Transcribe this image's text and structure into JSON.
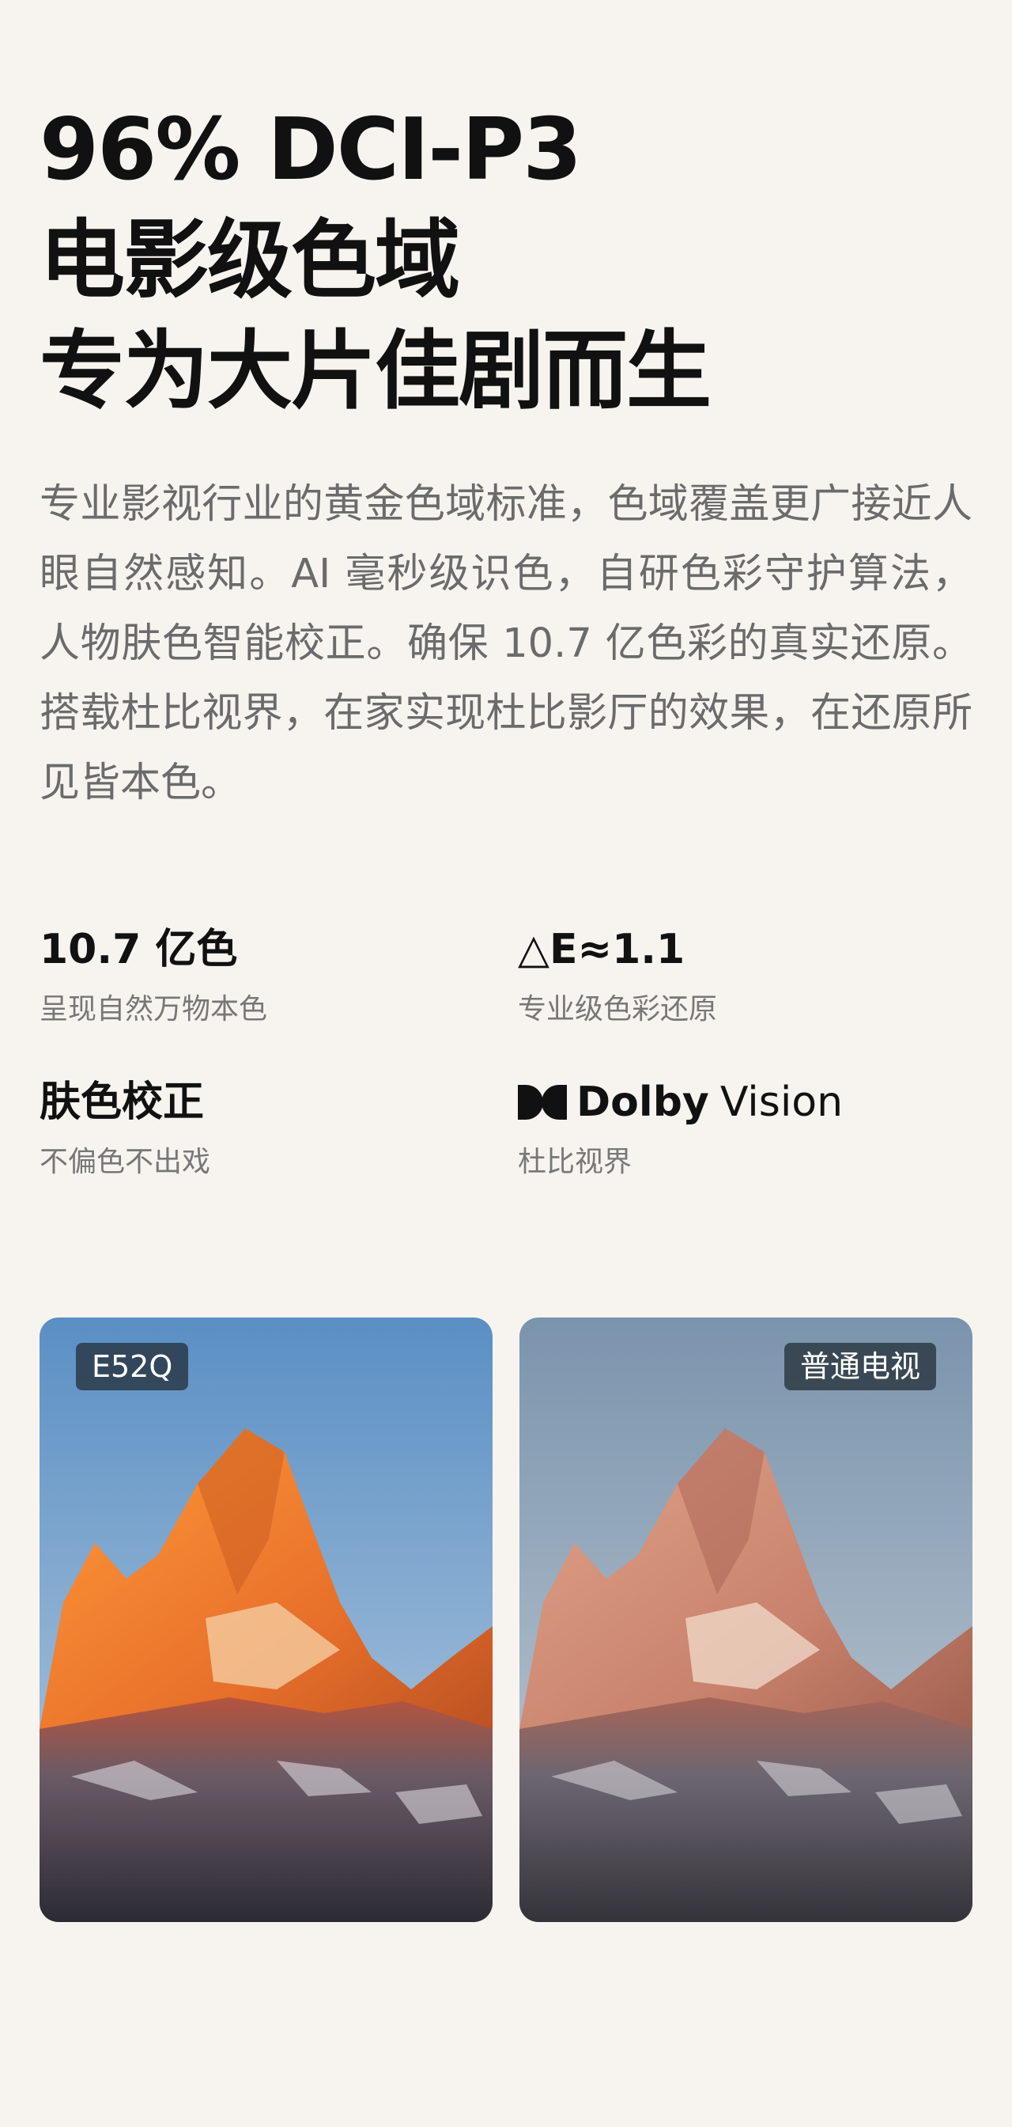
{
  "headline": {
    "line1": "96% DCI-P3",
    "line2": "电影级色域",
    "line3": "专为大片佳剧而生"
  },
  "intro": "专业影视行业的黄金色域标准，色域覆盖更广接近人眼自然感知。AI 毫秒级识色，自研色彩守护算法，人物肤色智能校正。确保 10.7 亿色彩的真实还原。搭载杜比视界，在家实现杜比影厅的效果，在还原所见皆本色。",
  "features": [
    {
      "title": "10.7 亿色",
      "desc": "呈现自然万物本色"
    },
    {
      "title": "△E≈1.1",
      "desc": "专业级色彩还原"
    },
    {
      "title": "肤色校正",
      "desc": "不偏色不出戏"
    },
    {
      "logo_word1": "Dolby",
      "logo_word2": "Vision",
      "desc": "杜比视界",
      "icon": "dolby-double-d-icon"
    }
  ],
  "comparison": {
    "left_label": "E52Q",
    "right_label": "普通电视",
    "colors": {
      "left_sky_top": "#5a8fc4",
      "left_mountain": "#e8702a",
      "right_sky_top": "#7a94ad",
      "right_mountain": "#c9826b"
    }
  }
}
